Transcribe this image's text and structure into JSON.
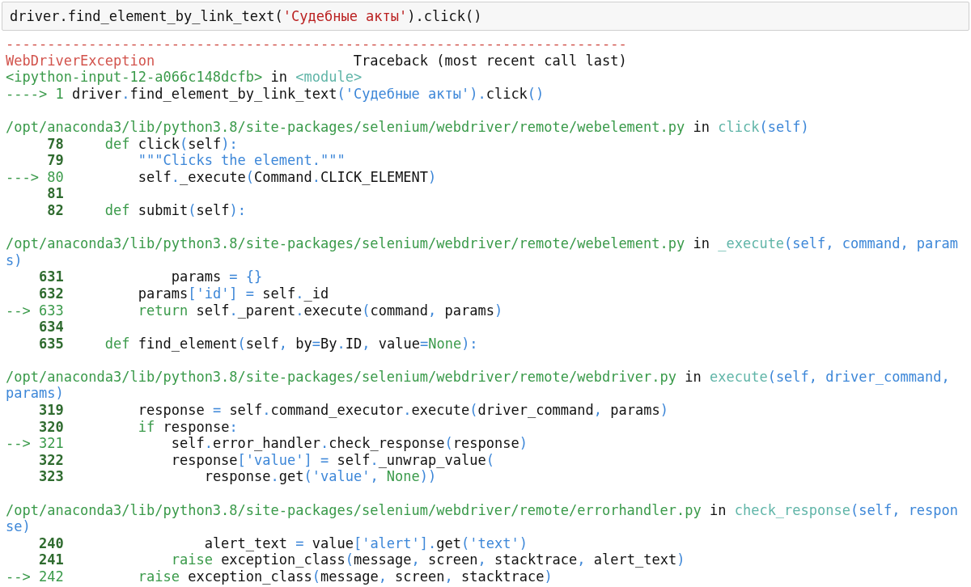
{
  "input_cell": {
    "parts": [
      {
        "kind": "plain",
        "text": "driver.find_element_by_link_text("
      },
      {
        "kind": "string",
        "text": "'Судебные акты'"
      },
      {
        "kind": "plain",
        "text": ").click()"
      }
    ]
  },
  "traceback": [
    {
      "kind": "code",
      "parts": [
        {
          "kind": "error",
          "text": "---------------------------------------------------------------------------"
        }
      ]
    },
    {
      "kind": "code",
      "parts": [
        {
          "kind": "error",
          "text": "WebDriverException"
        },
        {
          "kind": "plain",
          "text": "                        Traceback (most recent call last)"
        }
      ]
    },
    {
      "kind": "code",
      "parts": [
        {
          "kind": "green",
          "text": "<ipython-input-12-a066c148dcfb>"
        },
        {
          "kind": "plain",
          "text": " in "
        },
        {
          "kind": "func",
          "text": "<module>"
        }
      ]
    },
    {
      "kind": "code",
      "parts": [
        {
          "kind": "green",
          "text": "----> 1 "
        },
        {
          "kind": "plain",
          "text": "driver"
        },
        {
          "kind": "blue",
          "text": "."
        },
        {
          "kind": "plain",
          "text": "find_element_by_link_text"
        },
        {
          "kind": "blue",
          "text": "('Судебные акты')."
        },
        {
          "kind": "plain",
          "text": "click"
        },
        {
          "kind": "blue",
          "text": "()"
        }
      ]
    },
    {
      "kind": "blank"
    },
    {
      "kind": "code",
      "parts": [
        {
          "kind": "green",
          "text": "/opt/anaconda3/lib/python3.8/site-packages/selenium/webdriver/remote/webelement.py"
        },
        {
          "kind": "plain",
          "text": " in "
        },
        {
          "kind": "func",
          "text": "click"
        },
        {
          "kind": "blue",
          "text": "(self)"
        }
      ]
    },
    {
      "kind": "code",
      "parts": [
        {
          "kind": "lineno",
          "text": "     78"
        },
        {
          "kind": "green",
          "text": "     def"
        },
        {
          "kind": "plain",
          "text": " click"
        },
        {
          "kind": "blue",
          "text": "("
        },
        {
          "kind": "plain",
          "text": "self"
        },
        {
          "kind": "blue",
          "text": "):"
        }
      ]
    },
    {
      "kind": "code",
      "parts": [
        {
          "kind": "lineno",
          "text": "     79"
        },
        {
          "kind": "blue",
          "text": "         \"\"\"Clicks the element.\"\"\""
        }
      ]
    },
    {
      "kind": "code",
      "parts": [
        {
          "kind": "green",
          "text": "---> 80"
        },
        {
          "kind": "plain",
          "text": "         self"
        },
        {
          "kind": "blue",
          "text": "."
        },
        {
          "kind": "plain",
          "text": "_execute"
        },
        {
          "kind": "blue",
          "text": "("
        },
        {
          "kind": "plain",
          "text": "Command"
        },
        {
          "kind": "blue",
          "text": "."
        },
        {
          "kind": "plain",
          "text": "CLICK_ELEMENT"
        },
        {
          "kind": "blue",
          "text": ")"
        }
      ]
    },
    {
      "kind": "code",
      "parts": [
        {
          "kind": "lineno",
          "text": "     81"
        }
      ]
    },
    {
      "kind": "code",
      "parts": [
        {
          "kind": "lineno",
          "text": "     82"
        },
        {
          "kind": "green",
          "text": "     def"
        },
        {
          "kind": "plain",
          "text": " submit"
        },
        {
          "kind": "blue",
          "text": "("
        },
        {
          "kind": "plain",
          "text": "self"
        },
        {
          "kind": "blue",
          "text": "):"
        }
      ]
    },
    {
      "kind": "blank"
    },
    {
      "kind": "code",
      "parts": [
        {
          "kind": "green",
          "text": "/opt/anaconda3/lib/python3.8/site-packages/selenium/webdriver/remote/webelement.py"
        },
        {
          "kind": "plain",
          "text": " in "
        },
        {
          "kind": "func",
          "text": "_execute"
        },
        {
          "kind": "blue",
          "text": "(self, command, param"
        }
      ]
    },
    {
      "kind": "code",
      "parts": [
        {
          "kind": "blue",
          "text": "s)"
        }
      ]
    },
    {
      "kind": "code",
      "parts": [
        {
          "kind": "lineno",
          "text": "    631"
        },
        {
          "kind": "plain",
          "text": "             params "
        },
        {
          "kind": "blue",
          "text": "= {}"
        }
      ]
    },
    {
      "kind": "code",
      "parts": [
        {
          "kind": "lineno",
          "text": "    632"
        },
        {
          "kind": "plain",
          "text": "         params"
        },
        {
          "kind": "blue",
          "text": "['id'] ="
        },
        {
          "kind": "plain",
          "text": " self"
        },
        {
          "kind": "blue",
          "text": "."
        },
        {
          "kind": "plain",
          "text": "_id"
        }
      ]
    },
    {
      "kind": "code",
      "parts": [
        {
          "kind": "green",
          "text": "--> 633"
        },
        {
          "kind": "green",
          "text": "         return"
        },
        {
          "kind": "plain",
          "text": " self"
        },
        {
          "kind": "blue",
          "text": "."
        },
        {
          "kind": "plain",
          "text": "_parent"
        },
        {
          "kind": "blue",
          "text": "."
        },
        {
          "kind": "plain",
          "text": "execute"
        },
        {
          "kind": "blue",
          "text": "("
        },
        {
          "kind": "plain",
          "text": "command"
        },
        {
          "kind": "blue",
          "text": ","
        },
        {
          "kind": "plain",
          "text": " params"
        },
        {
          "kind": "blue",
          "text": ")"
        }
      ]
    },
    {
      "kind": "code",
      "parts": [
        {
          "kind": "lineno",
          "text": "    634"
        }
      ]
    },
    {
      "kind": "code",
      "parts": [
        {
          "kind": "lineno",
          "text": "    635"
        },
        {
          "kind": "green",
          "text": "     def"
        },
        {
          "kind": "plain",
          "text": " find_element"
        },
        {
          "kind": "blue",
          "text": "("
        },
        {
          "kind": "plain",
          "text": "self"
        },
        {
          "kind": "blue",
          "text": ","
        },
        {
          "kind": "plain",
          "text": " by"
        },
        {
          "kind": "blue",
          "text": "="
        },
        {
          "kind": "plain",
          "text": "By"
        },
        {
          "kind": "blue",
          "text": "."
        },
        {
          "kind": "plain",
          "text": "ID"
        },
        {
          "kind": "blue",
          "text": ","
        },
        {
          "kind": "plain",
          "text": " value"
        },
        {
          "kind": "blue",
          "text": "="
        },
        {
          "kind": "green",
          "text": "None"
        },
        {
          "kind": "blue",
          "text": "):"
        }
      ]
    },
    {
      "kind": "blank"
    },
    {
      "kind": "code",
      "parts": [
        {
          "kind": "green",
          "text": "/opt/anaconda3/lib/python3.8/site-packages/selenium/webdriver/remote/webdriver.py"
        },
        {
          "kind": "plain",
          "text": " in "
        },
        {
          "kind": "func",
          "text": "execute"
        },
        {
          "kind": "blue",
          "text": "(self, driver_command,"
        }
      ]
    },
    {
      "kind": "code",
      "parts": [
        {
          "kind": "blue",
          "text": "params)"
        }
      ]
    },
    {
      "kind": "code",
      "parts": [
        {
          "kind": "lineno",
          "text": "    319"
        },
        {
          "kind": "plain",
          "text": "         response "
        },
        {
          "kind": "blue",
          "text": "="
        },
        {
          "kind": "plain",
          "text": " self"
        },
        {
          "kind": "blue",
          "text": "."
        },
        {
          "kind": "plain",
          "text": "command_executor"
        },
        {
          "kind": "blue",
          "text": "."
        },
        {
          "kind": "plain",
          "text": "execute"
        },
        {
          "kind": "blue",
          "text": "("
        },
        {
          "kind": "plain",
          "text": "driver_command"
        },
        {
          "kind": "blue",
          "text": ","
        },
        {
          "kind": "plain",
          "text": " params"
        },
        {
          "kind": "blue",
          "text": ")"
        }
      ]
    },
    {
      "kind": "code",
      "parts": [
        {
          "kind": "lineno",
          "text": "    320"
        },
        {
          "kind": "green",
          "text": "         if"
        },
        {
          "kind": "plain",
          "text": " response"
        },
        {
          "kind": "blue",
          "text": ":"
        }
      ]
    },
    {
      "kind": "code",
      "parts": [
        {
          "kind": "green",
          "text": "--> 321"
        },
        {
          "kind": "plain",
          "text": "             self"
        },
        {
          "kind": "blue",
          "text": "."
        },
        {
          "kind": "plain",
          "text": "error_handler"
        },
        {
          "kind": "blue",
          "text": "."
        },
        {
          "kind": "plain",
          "text": "check_response"
        },
        {
          "kind": "blue",
          "text": "("
        },
        {
          "kind": "plain",
          "text": "response"
        },
        {
          "kind": "blue",
          "text": ")"
        }
      ]
    },
    {
      "kind": "code",
      "parts": [
        {
          "kind": "lineno",
          "text": "    322"
        },
        {
          "kind": "plain",
          "text": "             response"
        },
        {
          "kind": "blue",
          "text": "['value'] ="
        },
        {
          "kind": "plain",
          "text": " self"
        },
        {
          "kind": "blue",
          "text": "."
        },
        {
          "kind": "plain",
          "text": "_unwrap_value"
        },
        {
          "kind": "blue",
          "text": "("
        }
      ]
    },
    {
      "kind": "code",
      "parts": [
        {
          "kind": "lineno",
          "text": "    323"
        },
        {
          "kind": "plain",
          "text": "                 response"
        },
        {
          "kind": "blue",
          "text": "."
        },
        {
          "kind": "plain",
          "text": "get"
        },
        {
          "kind": "blue",
          "text": "('value', "
        },
        {
          "kind": "green",
          "text": "None"
        },
        {
          "kind": "blue",
          "text": "))"
        }
      ]
    },
    {
      "kind": "blank"
    },
    {
      "kind": "code",
      "parts": [
        {
          "kind": "green",
          "text": "/opt/anaconda3/lib/python3.8/site-packages/selenium/webdriver/remote/errorhandler.py"
        },
        {
          "kind": "plain",
          "text": " in "
        },
        {
          "kind": "func",
          "text": "check_response"
        },
        {
          "kind": "blue",
          "text": "(self, respon"
        }
      ]
    },
    {
      "kind": "code",
      "parts": [
        {
          "kind": "blue",
          "text": "se)"
        }
      ]
    },
    {
      "kind": "code",
      "parts": [
        {
          "kind": "lineno",
          "text": "    240"
        },
        {
          "kind": "plain",
          "text": "                 alert_text "
        },
        {
          "kind": "blue",
          "text": "="
        },
        {
          "kind": "plain",
          "text": " value"
        },
        {
          "kind": "blue",
          "text": "['alert']."
        },
        {
          "kind": "plain",
          "text": "get"
        },
        {
          "kind": "blue",
          "text": "('text')"
        }
      ]
    },
    {
      "kind": "code",
      "parts": [
        {
          "kind": "lineno",
          "text": "    241"
        },
        {
          "kind": "green",
          "text": "             raise"
        },
        {
          "kind": "plain",
          "text": " exception_class"
        },
        {
          "kind": "blue",
          "text": "("
        },
        {
          "kind": "plain",
          "text": "message"
        },
        {
          "kind": "blue",
          "text": ","
        },
        {
          "kind": "plain",
          "text": " screen"
        },
        {
          "kind": "blue",
          "text": ","
        },
        {
          "kind": "plain",
          "text": " stacktrace"
        },
        {
          "kind": "blue",
          "text": ","
        },
        {
          "kind": "plain",
          "text": " alert_text"
        },
        {
          "kind": "blue",
          "text": ")"
        }
      ]
    },
    {
      "kind": "code",
      "parts": [
        {
          "kind": "green",
          "text": "--> 242"
        },
        {
          "kind": "green",
          "text": "         raise"
        },
        {
          "kind": "plain",
          "text": " exception_class"
        },
        {
          "kind": "blue",
          "text": "("
        },
        {
          "kind": "plain",
          "text": "message"
        },
        {
          "kind": "blue",
          "text": ","
        },
        {
          "kind": "plain",
          "text": " screen"
        },
        {
          "kind": "blue",
          "text": ","
        },
        {
          "kind": "plain",
          "text": " stacktrace"
        },
        {
          "kind": "blue",
          "text": ")"
        }
      ]
    }
  ]
}
